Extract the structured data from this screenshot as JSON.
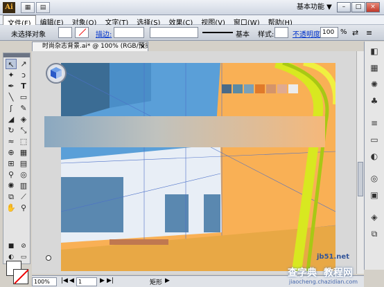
{
  "app": {
    "logo": "Ai",
    "workspace_label": "基本功能",
    "window_buttons": [
      "–",
      "□",
      "×"
    ]
  },
  "menu": {
    "items": [
      "文件(F)",
      "编辑(E)",
      "对象(O)",
      "文字(T)",
      "选择(S)",
      "效果(C)",
      "视图(V)",
      "窗口(W)",
      "帮助(H)"
    ]
  },
  "controlbar": {
    "selection_label": "未选择对象",
    "stroke_label": "描边:",
    "style_basic": "基本",
    "style_label": "样式:",
    "opacity_label": "不透明度:",
    "opacity_value": "100",
    "opacity_unit": "%"
  },
  "document": {
    "tab_title": "时尚杂志背景.ai* @ 100% (RGB/预览)",
    "tab_close": "×"
  },
  "canvas": {
    "swatch_colors": [
      "#4a6a88",
      "#5a8aa4",
      "#7aa0b8",
      "#e07a2a",
      "#d4946a",
      "#e0aa90",
      "#ececec"
    ]
  },
  "statusbar": {
    "zoom": "100%",
    "page": "1",
    "tool_name": "矩形"
  },
  "watermark": {
    "site": "查字典",
    "tutorial": "教程网",
    "url": "jb51.net",
    "sub": "jiaocheng.chazidian.com"
  }
}
